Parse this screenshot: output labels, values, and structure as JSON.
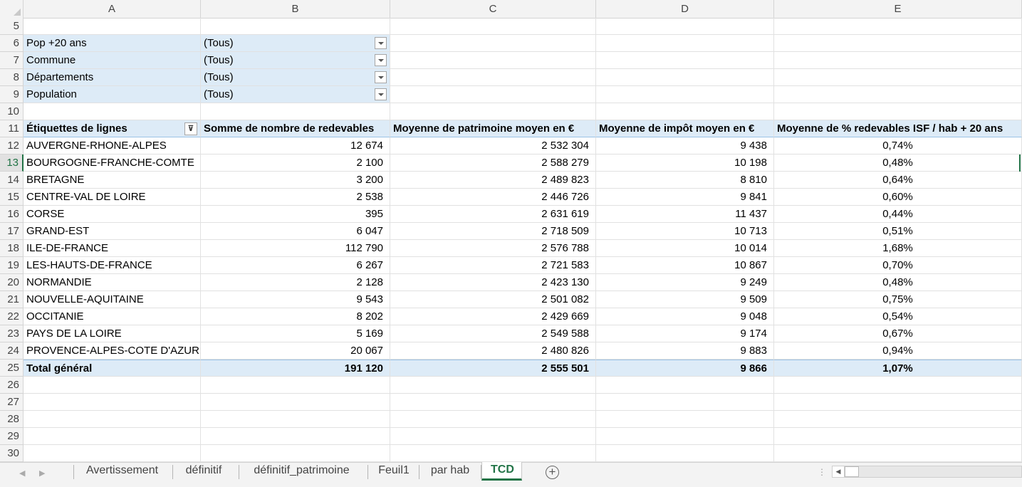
{
  "columns": [
    "A",
    "B",
    "C",
    "D",
    "E"
  ],
  "filters": [
    {
      "row": "6",
      "label": "Pop +20 ans",
      "value": "(Tous)"
    },
    {
      "row": "7",
      "label": "Commune",
      "value": "(Tous)"
    },
    {
      "row": "8",
      "label": "Départements",
      "value": "(Tous)"
    },
    {
      "row": "9",
      "label": "Population",
      "value": "(Tous)"
    }
  ],
  "empty_rows_top": [
    "5",
    "10"
  ],
  "header": {
    "row": "11",
    "labels": [
      "Étiquettes de lignes",
      "Somme de nombre de redevables",
      "Moyenne de patrimoine moyen en €",
      "Moyenne de impôt moyen en €",
      "Moyenne de % redevables ISF / hab + 20 ans"
    ]
  },
  "data_rows": [
    {
      "row": "12",
      "region": "AUVERGNE-RHONE-ALPES",
      "redevables": "12 674",
      "patrimoine": "2 532 304",
      "impot": "9 438",
      "pct": "0,74%"
    },
    {
      "row": "13",
      "region": "BOURGOGNE-FRANCHE-COMTE",
      "redevables": "2 100",
      "patrimoine": "2 588 279",
      "impot": "10 198",
      "pct": "0,48%"
    },
    {
      "row": "14",
      "region": "BRETAGNE",
      "redevables": "3 200",
      "patrimoine": "2 489 823",
      "impot": "8 810",
      "pct": "0,64%"
    },
    {
      "row": "15",
      "region": "CENTRE-VAL DE LOIRE",
      "redevables": "2 538",
      "patrimoine": "2 446 726",
      "impot": "9 841",
      "pct": "0,60%"
    },
    {
      "row": "16",
      "region": "CORSE",
      "redevables": "395",
      "patrimoine": "2 631 619",
      "impot": "11 437",
      "pct": "0,44%"
    },
    {
      "row": "17",
      "region": "GRAND-EST",
      "redevables": "6 047",
      "patrimoine": "2 718 509",
      "impot": "10 713",
      "pct": "0,51%"
    },
    {
      "row": "18",
      "region": "ILE-DE-FRANCE",
      "redevables": "112 790",
      "patrimoine": "2 576 788",
      "impot": "10 014",
      "pct": "1,68%"
    },
    {
      "row": "19",
      "region": "LES-HAUTS-DE-FRANCE",
      "redevables": "6 267",
      "patrimoine": "2 721 583",
      "impot": "10 867",
      "pct": "0,70%"
    },
    {
      "row": "20",
      "region": "NORMANDIE",
      "redevables": "2 128",
      "patrimoine": "2 423 130",
      "impot": "9 249",
      "pct": "0,48%"
    },
    {
      "row": "21",
      "region": "NOUVELLE-AQUITAINE",
      "redevables": "9 543",
      "patrimoine": "2 501 082",
      "impot": "9 509",
      "pct": "0,75%"
    },
    {
      "row": "22",
      "region": "OCCITANIE",
      "redevables": "8 202",
      "patrimoine": "2 429 669",
      "impot": "9 048",
      "pct": "0,54%"
    },
    {
      "row": "23",
      "region": "PAYS DE LA LOIRE",
      "redevables": "5 169",
      "patrimoine": "2 549 588",
      "impot": "9 174",
      "pct": "0,67%"
    },
    {
      "row": "24",
      "region": "PROVENCE-ALPES-COTE D'AZUR",
      "redevables": "20 067",
      "patrimoine": "2 480 826",
      "impot": "9 883",
      "pct": "0,94%"
    }
  ],
  "total": {
    "row": "25",
    "label": "Total général",
    "redevables": "191 120",
    "patrimoine": "2 555 501",
    "impot": "9 866",
    "pct": "1,07%"
  },
  "empty_rows_bottom": [
    "26",
    "27",
    "28",
    "29",
    "30"
  ],
  "active_row": "13",
  "sheet_tabs": [
    "Avertissement",
    "définitif",
    "définitif_patrimoine",
    "Feuil1",
    "par hab",
    "TCD"
  ],
  "active_tab": "TCD",
  "icons": {
    "filter_button": "filter-icon",
    "dropdown": "chevron-down-icon",
    "add_sheet": "plus-circle-icon"
  },
  "colors": {
    "accent": "#217346",
    "pivot_fill": "#ddebf7",
    "pivot_border": "#9bc2e6"
  }
}
